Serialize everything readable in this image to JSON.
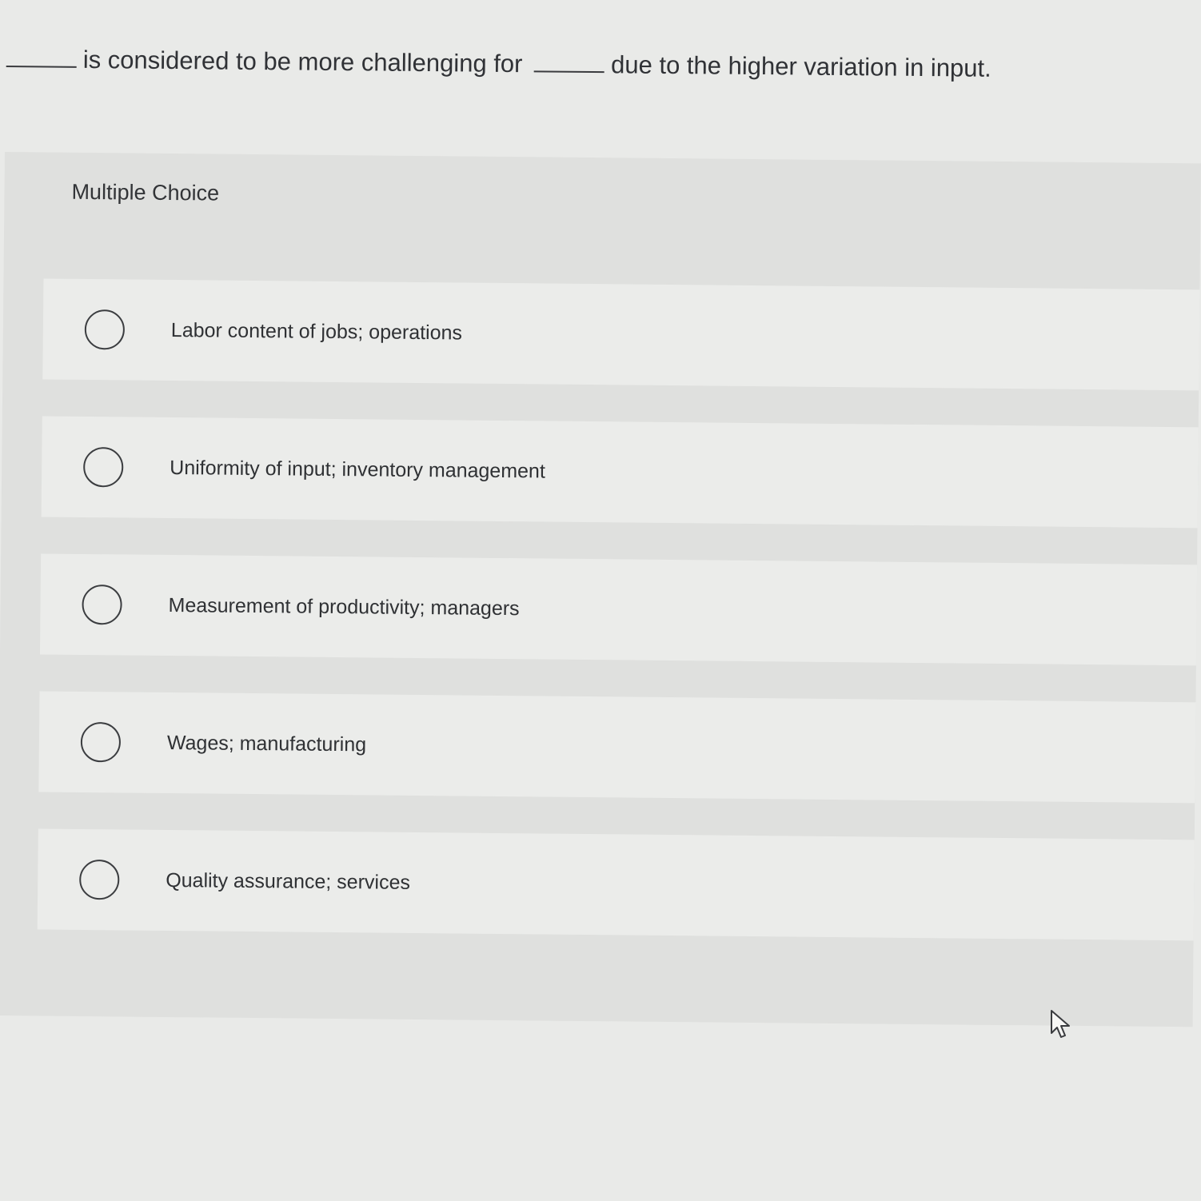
{
  "question": {
    "text_before": "",
    "text_middle": "is considered to be more challenging for",
    "text_after": "due to the higher variation in input."
  },
  "multiple_choice": {
    "label": "Multiple Choice",
    "options": [
      {
        "label": "Labor content of jobs; operations",
        "selected": false
      },
      {
        "label": "Uniformity of input; inventory management",
        "selected": false
      },
      {
        "label": "Measurement of productivity; managers",
        "selected": false
      },
      {
        "label": "Wages; manufacturing",
        "selected": false
      },
      {
        "label": "Quality assurance; services",
        "selected": false
      }
    ]
  },
  "icons": {
    "cursor": "mouse-pointer-icon",
    "radio": "radio-button-icon"
  },
  "colors": {
    "page_background": "#e9eae8",
    "panel_background": "#dfe0de",
    "option_background": "#ebecea",
    "text": "#2e3033"
  }
}
